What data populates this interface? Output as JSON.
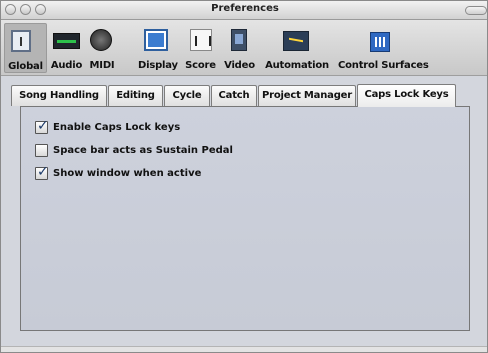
{
  "window": {
    "title": "Preferences"
  },
  "toolbar": {
    "items": [
      {
        "label": "Global",
        "icon": "global-icon",
        "selected": true
      },
      {
        "label": "Audio",
        "icon": "audio-icon"
      },
      {
        "label": "MIDI",
        "icon": "midi-icon"
      },
      {
        "label": "Display",
        "icon": "display-icon"
      },
      {
        "label": "Score",
        "icon": "score-icon"
      },
      {
        "label": "Video",
        "icon": "video-icon"
      },
      {
        "label": "Automation",
        "icon": "automation-icon"
      },
      {
        "label": "Control Surfaces",
        "icon": "control-surfaces-icon"
      }
    ]
  },
  "tabs": [
    {
      "label": "Song Handling"
    },
    {
      "label": "Editing"
    },
    {
      "label": "Cycle"
    },
    {
      "label": "Catch"
    },
    {
      "label": "Project Manager"
    },
    {
      "label": "Caps Lock Keys",
      "active": true
    }
  ],
  "options": [
    {
      "label": "Enable Caps Lock keys",
      "checked": true
    },
    {
      "label": "Space bar acts as Sustain Pedal",
      "checked": false
    },
    {
      "label": "Show window when active",
      "checked": true
    }
  ],
  "colors": {
    "panel": "#c9cdd8",
    "window": "#d3d6dd",
    "check": "#1c3a69"
  }
}
